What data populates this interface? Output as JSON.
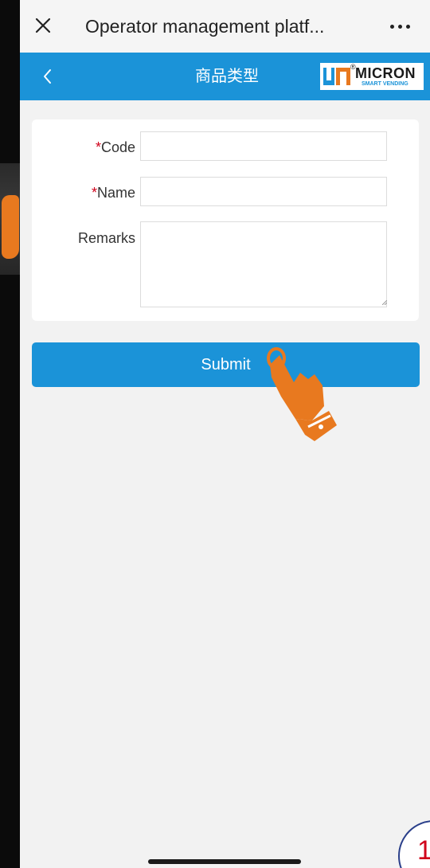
{
  "window": {
    "title": "Operator management platf...",
    "close_icon": "close-icon",
    "more_icon": "more-dots-icon"
  },
  "header": {
    "title": "商品类型",
    "back_icon": "chevron-left-icon",
    "logo": {
      "brand": "MICRON",
      "registered": "®",
      "tagline": "SMART VENDING"
    },
    "color": "#1b93d8"
  },
  "form": {
    "code_required_mark": "*",
    "code_label": "Code",
    "code_value": "",
    "name_required_mark": "*",
    "name_label": "Name",
    "name_value": "",
    "remarks_label": "Remarks",
    "remarks_value": ""
  },
  "submit_label": "Submit",
  "page_badge": "1",
  "colors": {
    "accent": "#1b93d8",
    "required": "#d0021b",
    "background": "#f2f2f2",
    "hand": "#e8791f"
  }
}
